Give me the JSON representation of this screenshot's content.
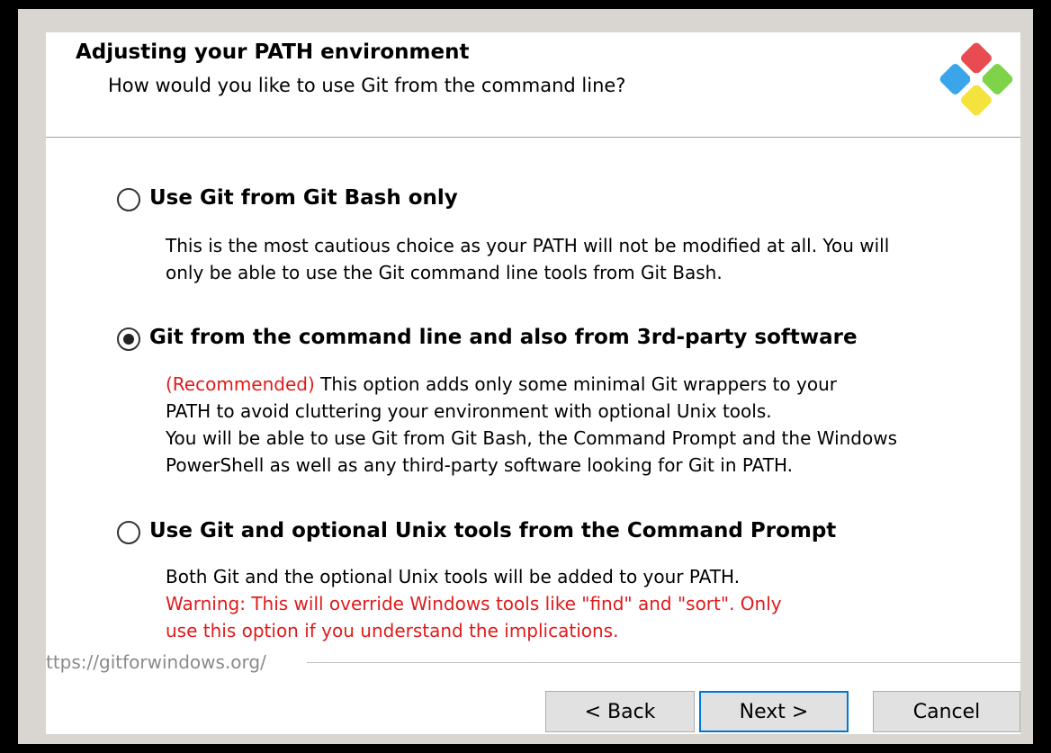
{
  "header": {
    "title": "Adjusting your PATH environment",
    "subtitle": "How would you like to use Git from the command line?",
    "logo_icon": "git-logo-icon"
  },
  "options": [
    {
      "label": "Use Git from Git Bash only",
      "selected": false,
      "desc": [
        "This is the most cautious choice as your PATH will not be modified at all. You will",
        "only be able to use the Git command line tools from Git Bash."
      ]
    },
    {
      "label": "Git from the command line and also from 3rd-party software",
      "selected": true,
      "recommended": "(Recommended)",
      "desc": [
        " This option adds only some minimal Git wrappers to your",
        "PATH to avoid cluttering your environment with optional Unix tools.",
        "You will be able to use Git from Git Bash, the Command Prompt and the Windows",
        "PowerShell as well as any third-party software looking for Git in PATH."
      ]
    },
    {
      "label": "Use Git and optional Unix tools from the Command Prompt",
      "selected": false,
      "desc": [
        "Both Git and the optional Unix tools will be added to your PATH."
      ],
      "warning": [
        "Warning: This will override Windows tools like \"find\" and \"sort\". Only",
        "use this option if you understand the implications."
      ]
    }
  ],
  "footer": {
    "link": "ttps://gitforwindows.org/"
  },
  "buttons": {
    "back": "< Back",
    "next": "Next >",
    "cancel": "Cancel"
  },
  "colors": {
    "warning": "#e01b1b",
    "focus_border": "#0078d7",
    "window_bg": "#ffffff",
    "frame_bg": "#d9d6d1"
  }
}
